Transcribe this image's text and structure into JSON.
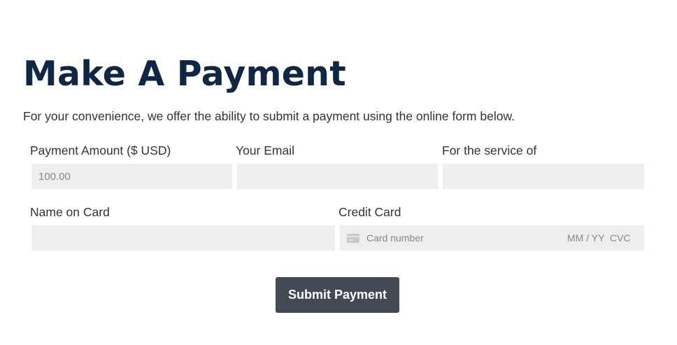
{
  "page": {
    "title": "Make A Payment",
    "intro": "For your convenience, we offer the ability to submit a payment using the online form below."
  },
  "form": {
    "amount": {
      "label": "Payment Amount ($ USD)",
      "placeholder": "100.00",
      "value": ""
    },
    "email": {
      "label": "Your Email",
      "placeholder": "",
      "value": ""
    },
    "service": {
      "label": "For the service of",
      "placeholder": "",
      "value": ""
    },
    "name": {
      "label": "Name on Card",
      "placeholder": "",
      "value": ""
    },
    "credit_card": {
      "label": "Credit Card",
      "number_placeholder": "Card number",
      "expiry_placeholder": "MM / YY",
      "cvc_placeholder": "CVC",
      "icon": "credit-card-icon"
    },
    "submit_label": "Submit Payment"
  },
  "colors": {
    "title": "#0f2744",
    "field_background": "#eeeeee",
    "button_background": "#444a53",
    "button_text": "#ffffff"
  }
}
